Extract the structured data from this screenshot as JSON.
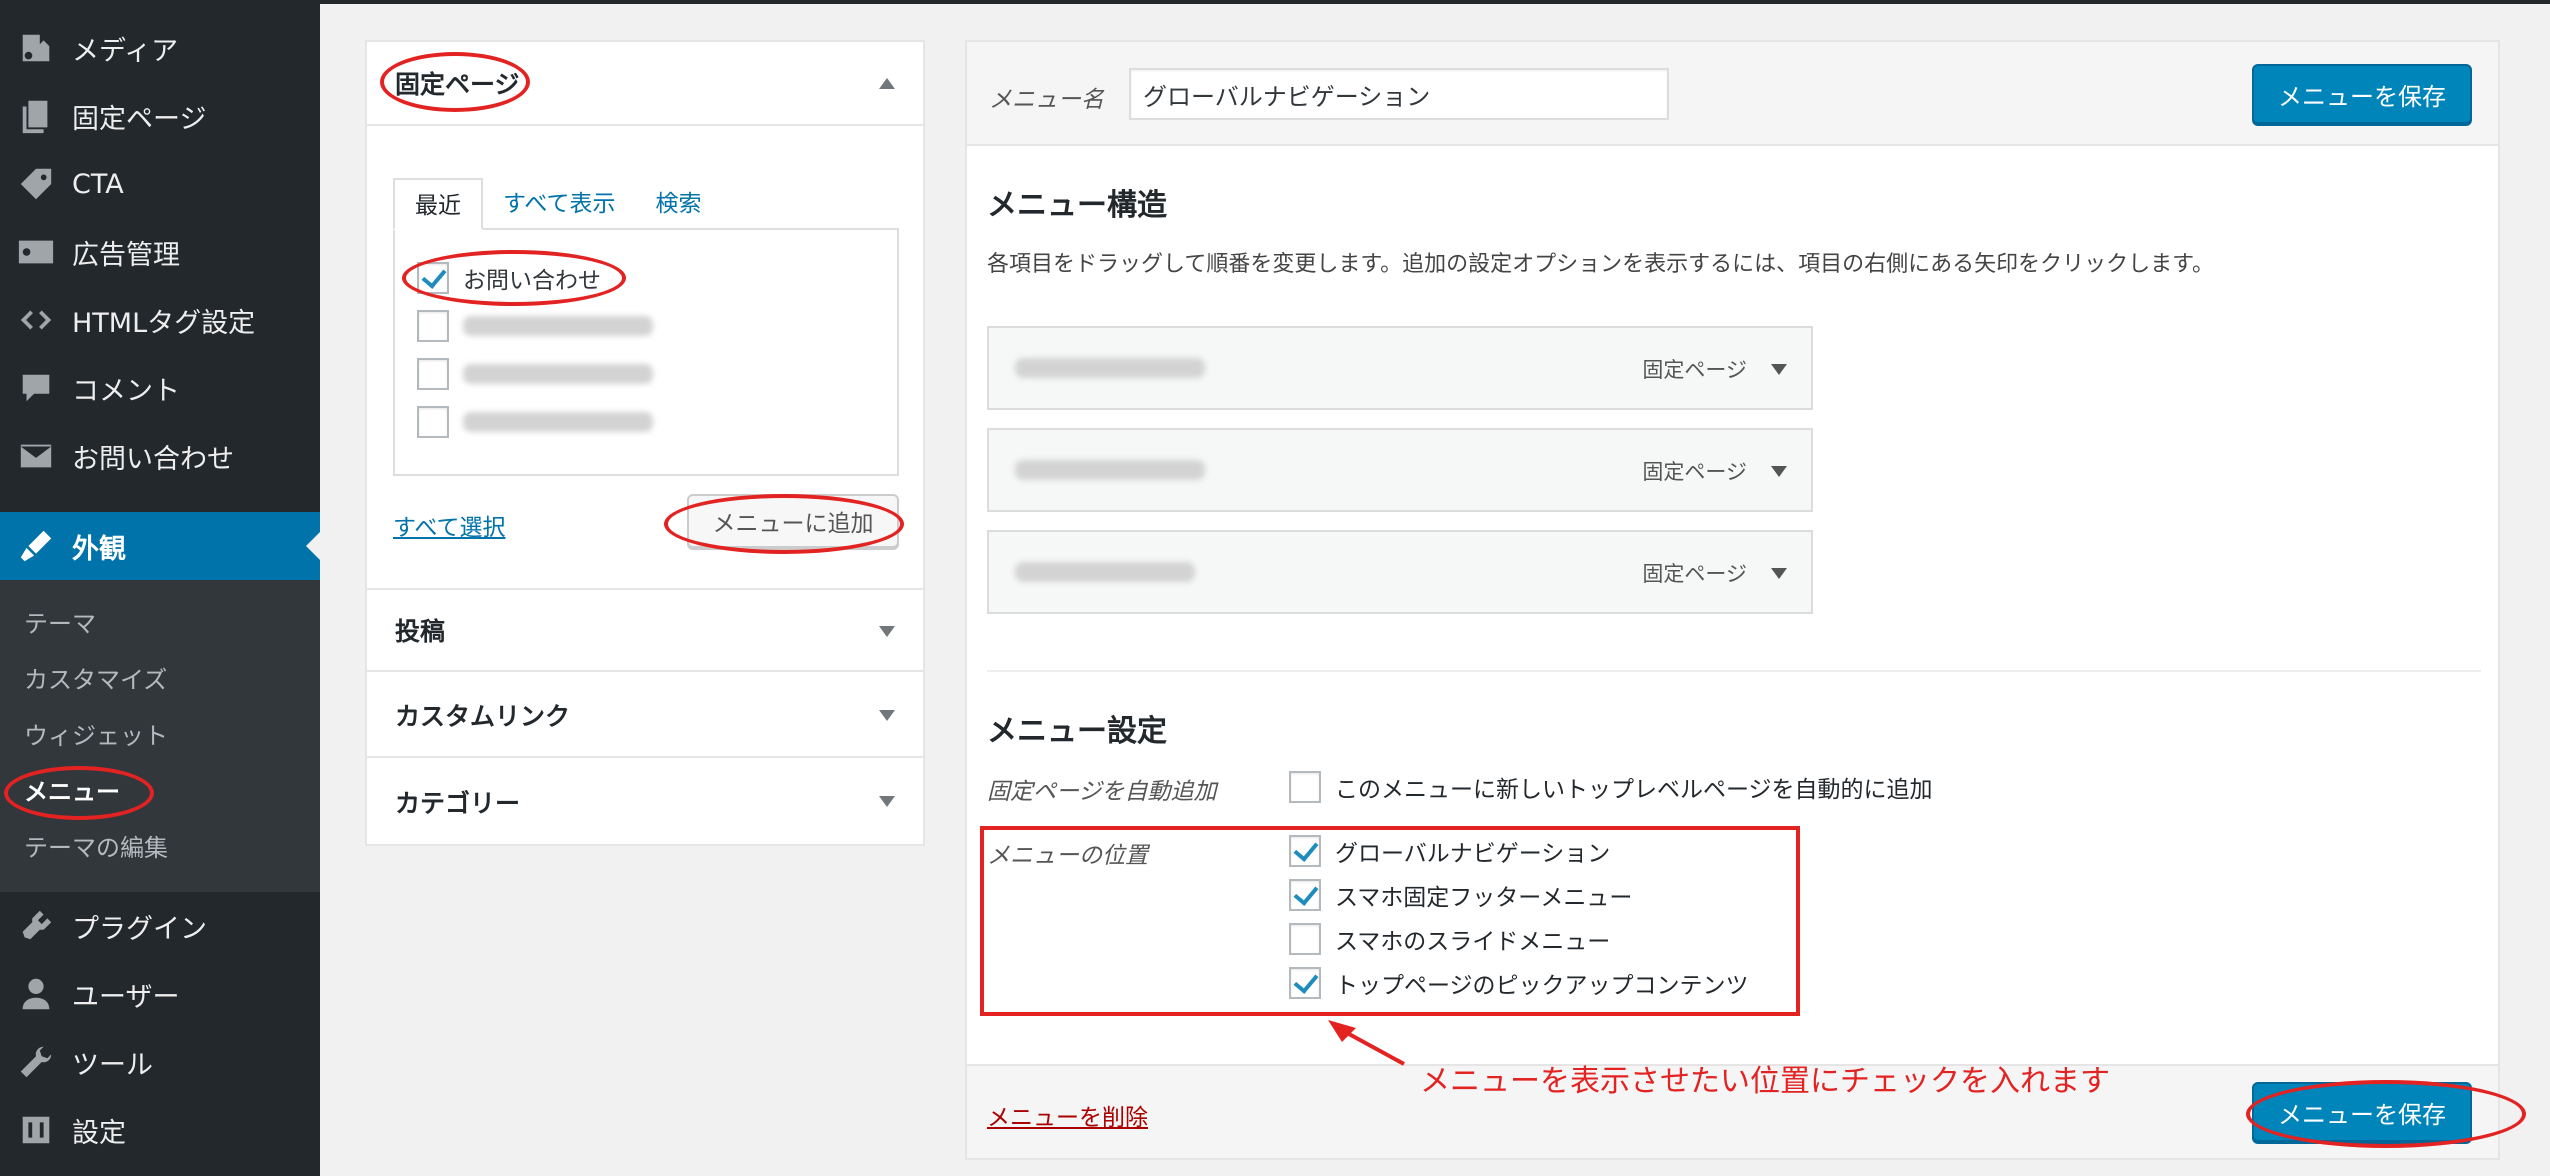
{
  "sidebar": {
    "items": [
      {
        "label": "メディア",
        "icon": "media-icon"
      },
      {
        "label": "固定ページ",
        "icon": "pages-icon"
      },
      {
        "label": "CTA",
        "icon": "tag-icon"
      },
      {
        "label": "広告管理",
        "icon": "ad-icon"
      },
      {
        "label": "HTMLタグ設定",
        "icon": "code-icon"
      },
      {
        "label": "コメント",
        "icon": "comment-icon"
      },
      {
        "label": "お問い合わせ",
        "icon": "mail-icon"
      },
      {
        "label": "外観",
        "icon": "appearance-icon"
      },
      {
        "label": "プラグイン",
        "icon": "plugin-icon"
      },
      {
        "label": "ユーザー",
        "icon": "user-icon"
      },
      {
        "label": "ツール",
        "icon": "wrench-icon"
      },
      {
        "label": "設定",
        "icon": "settings-icon"
      }
    ],
    "submenu": [
      "テーマ",
      "カスタマイズ",
      "ウィジェット",
      "メニュー",
      "テーマの編集"
    ]
  },
  "left_panel": {
    "pages_section": {
      "title": "固定ページ",
      "tabs": [
        "最近",
        "すべて表示",
        "検索"
      ],
      "items": [
        {
          "label": "お問い合わせ",
          "checked": true
        },
        {
          "label": "",
          "checked": false
        },
        {
          "label": "",
          "checked": false
        },
        {
          "label": "",
          "checked": false
        }
      ],
      "select_all": "すべて選択",
      "add_button": "メニューに追加"
    },
    "sections": [
      "投稿",
      "カスタムリンク",
      "カテゴリー"
    ]
  },
  "right_panel": {
    "menu_name_label": "メニュー名",
    "menu_name_value": "グローバルナビゲーション",
    "save_button": "メニューを保存",
    "structure_title": "メニュー構造",
    "structure_desc": "各項目をドラッグして順番を変更します。追加の設定オプションを表示するには、項目の右側にある矢印をクリックします。",
    "menu_items": [
      {
        "type": "固定ページ"
      },
      {
        "type": "固定ページ"
      },
      {
        "type": "固定ページ"
      }
    ],
    "settings_title": "メニュー設定",
    "auto_add_label": "固定ページを自動追加",
    "auto_add_option": "このメニューに新しいトップレベルページを自動的に追加",
    "location_label": "メニューの位置",
    "locations": [
      {
        "label": "グローバルナビゲーション",
        "checked": true
      },
      {
        "label": "スマホ固定フッターメニュー",
        "checked": true
      },
      {
        "label": "スマホのスライドメニュー",
        "checked": false
      },
      {
        "label": "トップページのピックアップコンテンツ",
        "checked": true
      }
    ],
    "delete_link": "メニューを削除"
  },
  "annotation": {
    "note": "メニューを表示させたい位置にチェックを入れます",
    "color": "#e32222"
  },
  "colors": {
    "sidebar_bg": "#23282d",
    "active": "#0073aa",
    "primary_button": "#0085ba"
  }
}
